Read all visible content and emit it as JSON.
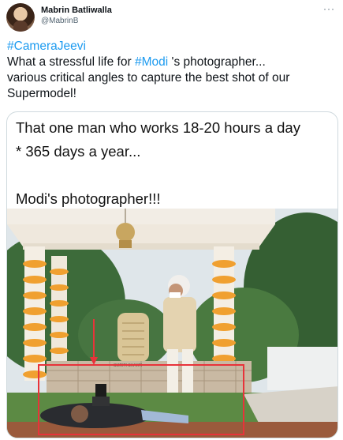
{
  "author": {
    "name": "Mabrin Batliwalla",
    "handle": "@MabrinB"
  },
  "menu": {
    "more_label": "···"
  },
  "tweet": {
    "hashtag": "#CameraJeevi",
    "line1_pre": "What a stressful life for ",
    "mention_tag": "#Modi",
    "line1_post": " 's photographer...",
    "line2": "various critical angles to capture the best shot of our",
    "line3": "Supermodel!"
  },
  "image_caption": {
    "line1": "That one man who works 18-20 hours a day",
    "line2": "* 365 days a year...",
    "line3": "Modi's photographer!!!"
  },
  "photo_sign": "SMRITI SHAKTI",
  "colors": {
    "link": "#1d9bf0",
    "highlight_box": "#e8333a",
    "marigold": "#f0a030"
  }
}
